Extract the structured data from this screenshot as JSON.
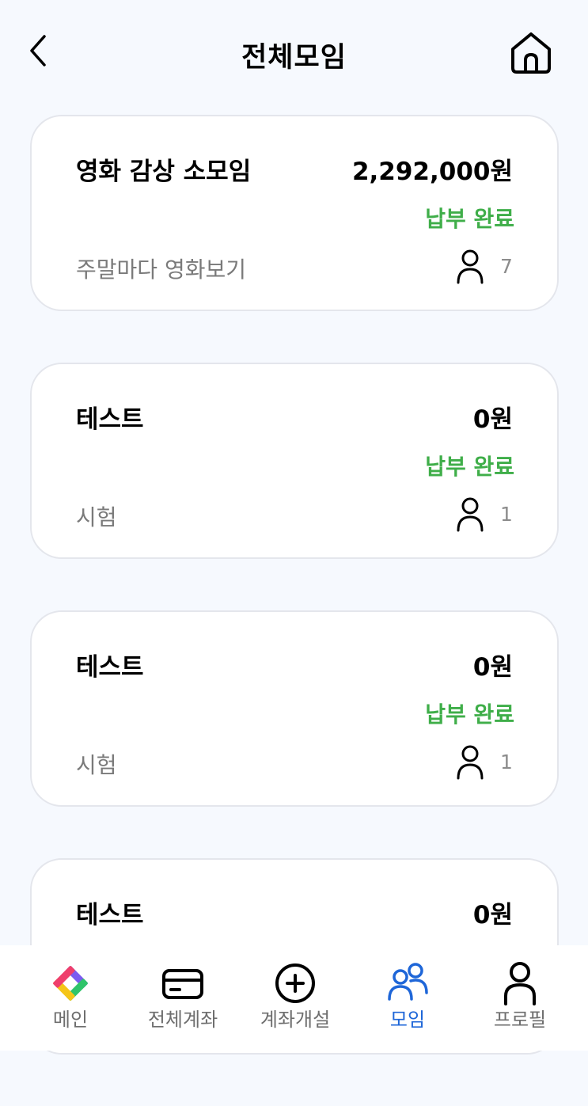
{
  "header": {
    "title": "전체모임",
    "back_icon": "chevron-left-icon",
    "home_icon": "home-icon"
  },
  "groups": [
    {
      "name": "영화 감상 소모임",
      "amount": "2,292,000원",
      "status": "납부 완료",
      "description": "주말마다 영화보기",
      "members": "7"
    },
    {
      "name": "테스트",
      "amount": "0원",
      "status": "납부 완료",
      "description": "시험",
      "members": "1"
    },
    {
      "name": "테스트",
      "amount": "0원",
      "status": "납부 완료",
      "description": "시험",
      "members": "1"
    },
    {
      "name": "테스트",
      "amount": "0원",
      "status": "",
      "description": "",
      "members": ""
    }
  ],
  "colors": {
    "status_green": "#3fae49",
    "active_tab": "#1e66d8",
    "background": "#f6f9fe"
  },
  "tabbar": {
    "items": [
      {
        "label": "메인",
        "icon": "app-logo-icon"
      },
      {
        "label": "전체계좌",
        "icon": "card-icon"
      },
      {
        "label": "계좌개설",
        "icon": "plus-circle-icon"
      },
      {
        "label": "모임",
        "icon": "group-icon",
        "active": true
      },
      {
        "label": "프로필",
        "icon": "person-icon"
      }
    ]
  }
}
